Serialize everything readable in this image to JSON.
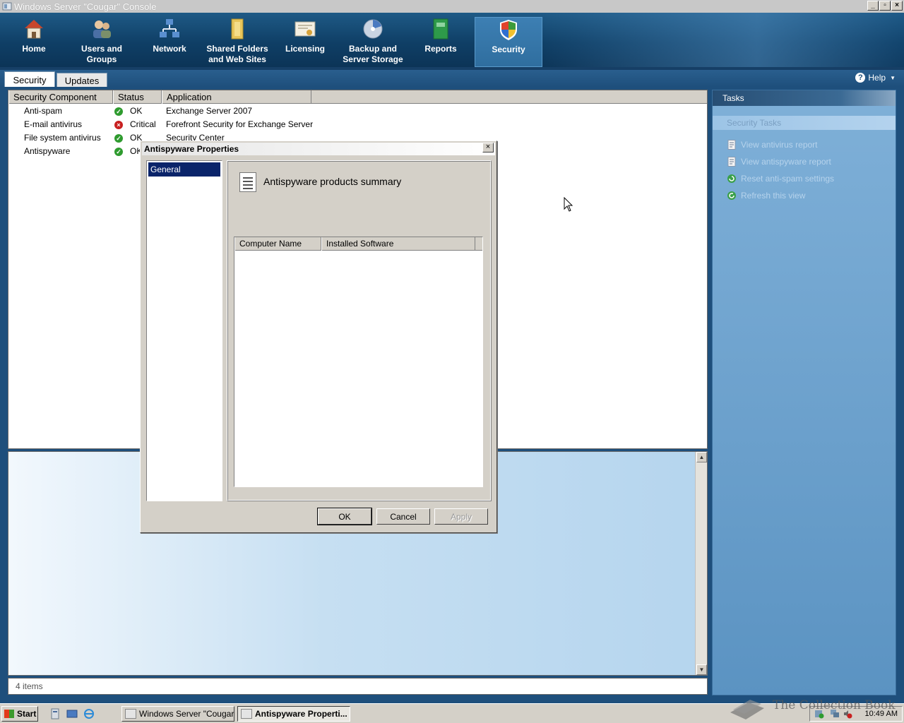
{
  "window": {
    "title": "Windows Server \"Cougar\" Console",
    "controls": {
      "minimize": "_",
      "restore": "▫",
      "close": "×"
    }
  },
  "ribbon": {
    "items": [
      {
        "label": "Home",
        "icon": "house-icon"
      },
      {
        "label": "Users and Groups",
        "icon": "users-icon"
      },
      {
        "label": "Network",
        "icon": "network-icon"
      },
      {
        "label": "Shared Folders and Web Sites",
        "icon": "folder-icon"
      },
      {
        "label": "Licensing",
        "icon": "certificate-icon"
      },
      {
        "label": "Backup and Server Storage",
        "icon": "backup-disk-icon"
      },
      {
        "label": "Reports",
        "icon": "report-book-icon"
      },
      {
        "label": "Security",
        "icon": "shield-icon",
        "active": true
      }
    ]
  },
  "tabs": [
    {
      "label": "Security",
      "active": true
    },
    {
      "label": "Updates",
      "active": false
    }
  ],
  "help": {
    "label": "Help"
  },
  "list": {
    "columns": [
      "Security Component",
      "Status",
      "Application"
    ],
    "rows": [
      {
        "component": "Anti-spam",
        "status": "OK",
        "status_kind": "ok",
        "application": "Exchange Server 2007"
      },
      {
        "component": "E-mail antivirus",
        "status": "Critical",
        "status_kind": "critical",
        "application": "Forefront Security for Exchange Server"
      },
      {
        "component": "File system antivirus",
        "status": "OK",
        "status_kind": "ok",
        "application": "Security Center"
      },
      {
        "component": "Antispyware",
        "status": "OK",
        "status_kind": "ok",
        "application": ""
      }
    ]
  },
  "status_bar": {
    "text": "4 items"
  },
  "tasks_pane": {
    "header": "Tasks",
    "section": "Security Tasks",
    "items": [
      {
        "label": "View antivirus report",
        "icon": "document-icon"
      },
      {
        "label": "View antispyware report",
        "icon": "document-icon"
      },
      {
        "label": "Reset anti-spam settings",
        "icon": "reset-icon"
      },
      {
        "label": "Refresh this view",
        "icon": "refresh-icon"
      }
    ]
  },
  "dialog": {
    "title": "Antispyware Properties",
    "nav": [
      "General"
    ],
    "page_title": "Antispyware products summary",
    "list_columns": [
      "Computer Name",
      "Installed Software"
    ],
    "buttons": {
      "ok": "OK",
      "cancel": "Cancel",
      "apply": "Apply"
    }
  },
  "taskbar": {
    "start": "Start",
    "buttons": [
      {
        "label": "Windows Server \"Cougar...",
        "pressed": false
      },
      {
        "label": "Antispyware Properti...",
        "pressed": true
      }
    ],
    "clock": "10:49 AM"
  },
  "watermark": "The Collection Book",
  "colors": {
    "ribbon_bg": "#0f3f66",
    "ok_green": "#2f9b2f",
    "critical_red": "#c82020",
    "selection": "#0a246a"
  }
}
